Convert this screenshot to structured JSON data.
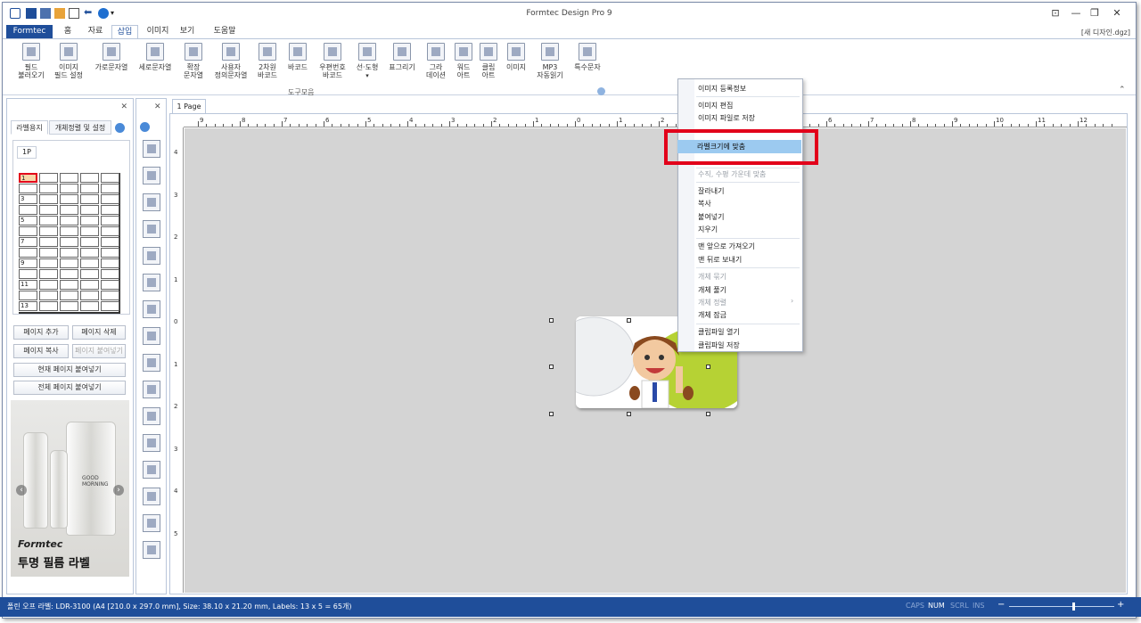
{
  "window": {
    "title": "Formtec Design Pro 9",
    "filename": "[새 디자인.dgz]",
    "controls": [
      "⊡",
      "—",
      "❐",
      "✕"
    ]
  },
  "ribbon_tabs": [
    "Formtec",
    "홈",
    "자료",
    "삽입",
    "이미지",
    "보기",
    "도움말"
  ],
  "ribbon": {
    "buttons": [
      "필드\n불러오기",
      "이미지\n필드 설정",
      "가로문자열",
      "세로문자열",
      "확장\n문자열",
      "사용자\n정의문자열",
      "2차원\n바코드",
      "바코드",
      "우편번호\n바코드",
      "선·도형",
      "표그리기",
      "그라\n데이션",
      "워드\n아트",
      "클립\n아트",
      "이미지",
      "MP3\n자동읽기",
      "특수문자"
    ],
    "group_label": "도구모음"
  },
  "left_panel": {
    "tabs": [
      "라벨용지",
      "개체정렬 및 설정"
    ],
    "page_chip": "1P",
    "row_numbers": [
      "1",
      "3",
      "5",
      "7",
      "9",
      "11",
      "13"
    ],
    "buttons": {
      "add_page": "페이지 추가",
      "delete_page": "페이지 삭제",
      "copy_page": "페이지 복사",
      "paste_page": "페이지 붙여넣기",
      "paste_current": "현재 페이지 붙여넣기",
      "paste_all": "전체 페이지 붙여넣기"
    },
    "banner": {
      "logo": "Formtec",
      "text": "투명 필름 라벨",
      "bottle_text": "GOOD\nMORNING"
    }
  },
  "document_tab": "1 Page",
  "rulers": {
    "top": [
      "9",
      "8",
      "7",
      "6",
      "5",
      "4",
      "3",
      "2",
      "1",
      "0",
      "1",
      "2",
      "3",
      "4",
      "5",
      "6",
      "7",
      "8",
      "9",
      "10",
      "11",
      "12"
    ],
    "left": [
      "4",
      "3",
      "2",
      "1",
      "0",
      "1",
      "2",
      "3",
      "4",
      "5"
    ]
  },
  "context_menu": {
    "items": [
      {
        "label": "이미지 등록정보",
        "enabled": true
      },
      {
        "label": "이미지 편집",
        "enabled": true
      },
      {
        "label": "이미지 파일로 저장",
        "enabled": true
      },
      {
        "label": "라벨크기에 맞춤",
        "enabled": true,
        "highlighted": true
      },
      {
        "label": "수직, 수평 가운데 맞춤",
        "enabled": false
      },
      {
        "label": "잘라내기",
        "enabled": true
      },
      {
        "label": "복사",
        "enabled": true
      },
      {
        "label": "붙여넣기",
        "enabled": true
      },
      {
        "label": "지우기",
        "enabled": true
      },
      {
        "label": "맨 앞으로 가져오기",
        "enabled": true
      },
      {
        "label": "맨 뒤로 보내기",
        "enabled": true
      },
      {
        "label": "개체 묶기",
        "enabled": false
      },
      {
        "label": "개체 풀기",
        "enabled": true
      },
      {
        "label": "개체 정렬",
        "enabled": false
      },
      {
        "label": "개체 잠금",
        "enabled": true
      },
      {
        "label": "클립파일 열기",
        "enabled": true
      },
      {
        "label": "클립파일 저장",
        "enabled": true
      }
    ],
    "submenu_arrow": "›"
  },
  "status_bar": {
    "label_info": "폴린 오프 라벨: LDR-3100 (A4 [210.0 x 297.0 mm], Size: 38.10 x 21.20 mm,  Labels: 13 x 5 = 65개)",
    "caps": "CAPS",
    "num": "NUM",
    "scrl": "SCRL",
    "ins": "INS",
    "zoom_minus": "−",
    "zoom_plus": "+"
  },
  "colors": {
    "accent": "#1f4e9a",
    "highlight_border": "#e2001a",
    "menu_highlight": "#9ccaf0",
    "workarea": "#d4d4d4"
  }
}
